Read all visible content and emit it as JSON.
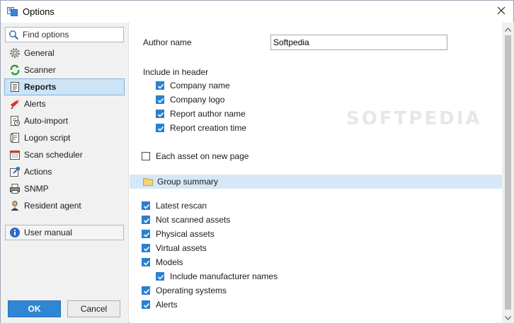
{
  "window": {
    "title": "Options",
    "app_icon": "options-app-icon",
    "close_icon": "close-icon"
  },
  "sidebar": {
    "search": {
      "placeholder": "Find options",
      "icon": "search-icon"
    },
    "items": [
      {
        "label": "General",
        "icon": "gear-icon",
        "selected": false
      },
      {
        "label": "Scanner",
        "icon": "scanner-icon",
        "selected": false
      },
      {
        "label": "Reports",
        "icon": "report-icon",
        "selected": true
      },
      {
        "label": "Alerts",
        "icon": "alert-icon",
        "selected": false
      },
      {
        "label": "Auto-import",
        "icon": "auto-import-icon",
        "selected": false
      },
      {
        "label": "Logon script",
        "icon": "script-icon",
        "selected": false
      },
      {
        "label": "Scan scheduler",
        "icon": "calendar-icon",
        "selected": false
      },
      {
        "label": "Actions",
        "icon": "actions-icon",
        "selected": false
      },
      {
        "label": "SNMP",
        "icon": "printer-icon",
        "selected": false
      },
      {
        "label": "Resident agent",
        "icon": "agent-icon",
        "selected": false
      }
    ],
    "manual": {
      "label": "User manual",
      "icon": "info-icon"
    },
    "ok_label": "OK",
    "cancel_label": "Cancel"
  },
  "reports": {
    "author_label": "Author name",
    "author_value": "Softpedia",
    "header_label": "Include in header",
    "header_options": [
      {
        "label": "Company name",
        "checked": true
      },
      {
        "label": "Company logo",
        "checked": true
      },
      {
        "label": "Report author name",
        "checked": true
      },
      {
        "label": "Report creation time",
        "checked": true
      }
    ],
    "each_asset": {
      "label": "Each asset on new page",
      "checked": false
    },
    "group_summary": {
      "label": "Group summary",
      "icon": "folder-icon"
    },
    "summary_options": [
      {
        "label": "Latest rescan",
        "checked": true
      },
      {
        "label": "Not scanned assets",
        "checked": true
      },
      {
        "label": "Physical assets",
        "checked": true
      },
      {
        "label": "Virtual assets",
        "checked": true
      },
      {
        "label": "Models",
        "checked": true
      },
      {
        "label": "Include manufacturer names",
        "checked": true
      },
      {
        "label": "Operating systems",
        "checked": true
      },
      {
        "label": "Alerts",
        "checked": true
      }
    ],
    "watermark": "SOFTPEDIA"
  },
  "colors": {
    "accent": "#2f86d4",
    "selection": "#cde4f7",
    "group_bar": "#d6e8f8"
  }
}
